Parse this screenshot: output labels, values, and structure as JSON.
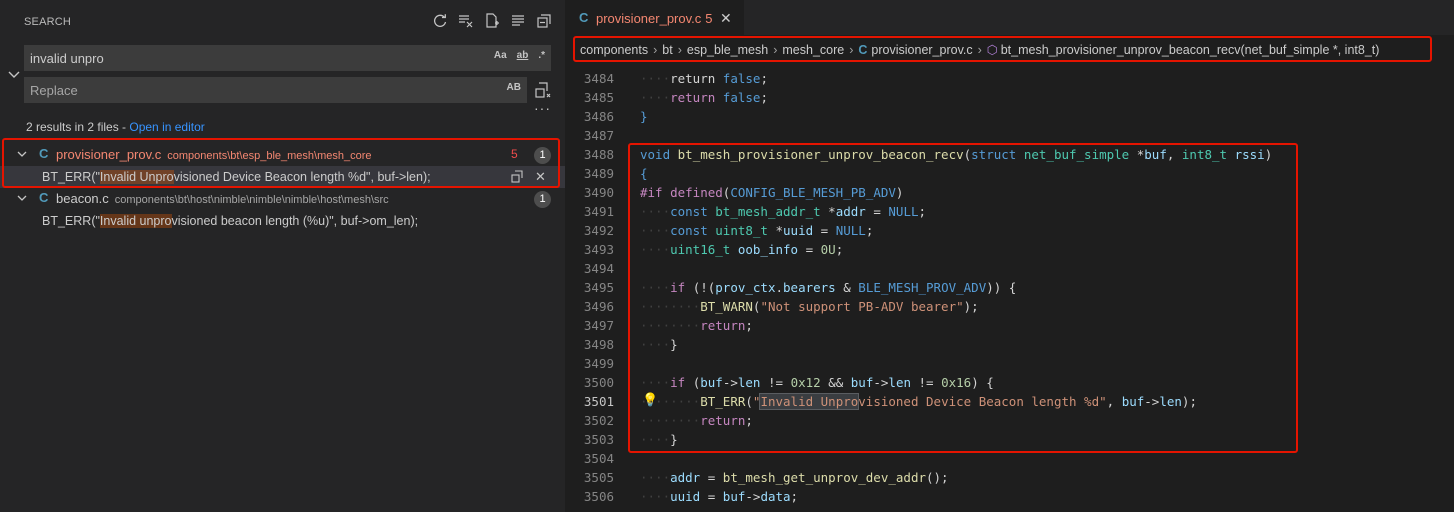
{
  "search": {
    "title": "SEARCH",
    "query": "invalid unpro",
    "replace_placeholder": "Replace",
    "opt_case": "Aa",
    "opt_word": "ab",
    "opt_regex": ".*",
    "opt_preserve_case": "AB",
    "summary": "2 results in 2 files - ",
    "open_in_editor": "Open in editor",
    "results": [
      {
        "file": "provisioner_prov.c",
        "path": "components\\bt\\esp_ble_mesh\\mesh_core",
        "problems": "5",
        "count": "1",
        "match_pre": "BT_ERR(\"",
        "match_hl": "Invalid Unpro",
        "match_post": "visioned Device Beacon length %d\", buf->len);"
      },
      {
        "file": "beacon.c",
        "path": "components\\bt\\host\\nimble\\nimble\\nimble\\host\\mesh\\src",
        "count": "1",
        "match_pre": "BT_ERR(\"",
        "match_hl": "Invalid unpro",
        "match_post": "visioned beacon length (%u)\", buf->om_len);"
      }
    ]
  },
  "editor": {
    "tab_icon": "C",
    "tab_name": "provisioner_prov.c",
    "tab_problems": "5",
    "breadcrumbs": [
      "components",
      "bt",
      "esp_ble_mesh",
      "mesh_core",
      "provisioner_prov.c",
      "bt_mesh_provisioner_unprov_beacon_recv(net_buf_simple *, int8_t)"
    ],
    "line_numbers": [
      "3484",
      "3485",
      "3486",
      "3487",
      "3488",
      "3489",
      "3490",
      "3491",
      "3492",
      "3493",
      "3494",
      "3495",
      "3496",
      "3497",
      "3498",
      "3499",
      "3500",
      "3501",
      "3502",
      "3503",
      "3504",
      "3505",
      "3506"
    ],
    "active_line": "3501"
  },
  "colors": {
    "highlight_box": "#e51400",
    "accent_link": "#3794ff",
    "c_icon": "#519aba"
  },
  "icons": [
    "refresh-icon",
    "clear-results-icon",
    "new-search-editor-icon",
    "collapse-all-icon",
    "view-as-tree-icon",
    "chevron-down-icon",
    "replace-all-icon",
    "close-icon",
    "lightbulb-icon",
    "method-cube-icon"
  ]
}
